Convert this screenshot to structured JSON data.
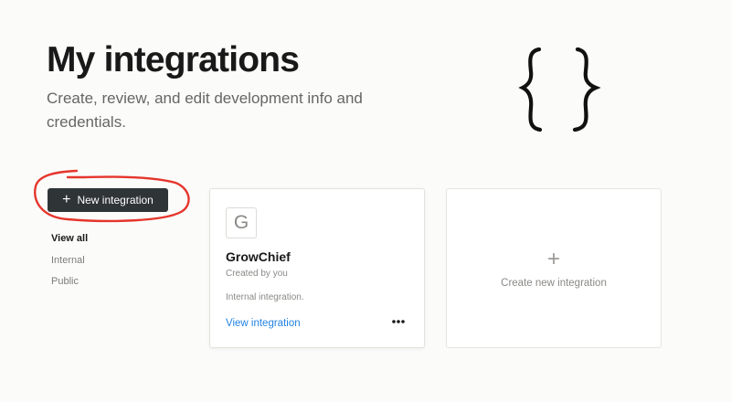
{
  "header": {
    "title": "My integrations",
    "subtitle": "Create, review, and edit development info and credentials."
  },
  "sidebar": {
    "new_button": {
      "icon": "plus-icon",
      "label": "New integration"
    },
    "filters": [
      {
        "label": "View all",
        "active": true
      },
      {
        "label": "Internal",
        "active": false
      },
      {
        "label": "Public",
        "active": false
      }
    ]
  },
  "integrations": [
    {
      "avatar_letter": "G",
      "name": "GrowChief",
      "creator": "Created by you",
      "type": "Internal integration.",
      "link_label": "View integration",
      "more_icon": "more-horizontal-icon"
    }
  ],
  "create_card": {
    "icon": "plus-icon",
    "label": "Create new integration"
  },
  "colors": {
    "page_background": "#fbfbfa",
    "button_dark": "#2f3437",
    "link_blue": "#2383e2",
    "annotation_red": "#e5352b"
  }
}
